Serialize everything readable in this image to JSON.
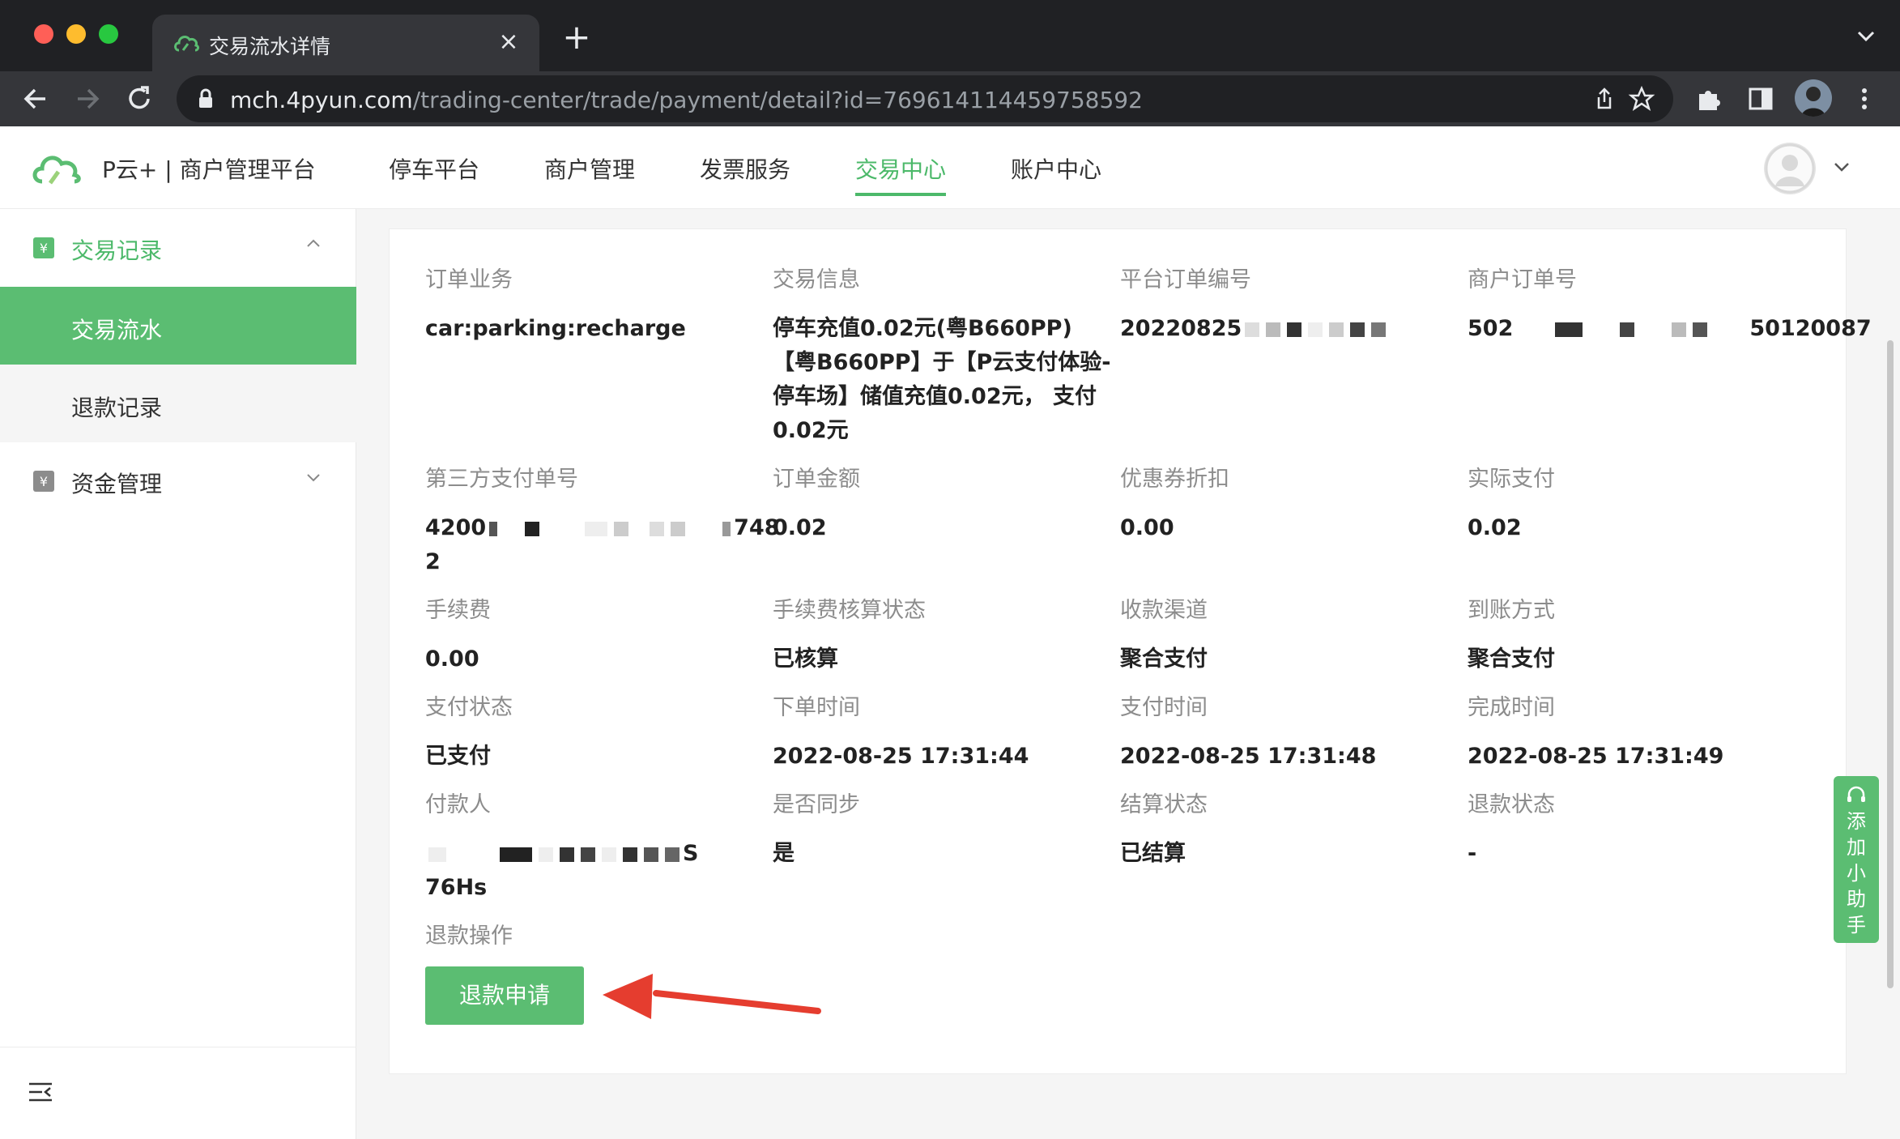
{
  "browser": {
    "tab_title": "交易流水详情",
    "tab_close": "×",
    "new_tab": "+",
    "url_host": "mch.4pyun.com",
    "url_path": "/trading-center/trade/payment/detail?id=769614114459758592"
  },
  "header": {
    "brand": "P云+ | 商户管理平台",
    "nav": [
      "停车平台",
      "商户管理",
      "发票服务",
      "交易中心",
      "账户中心"
    ],
    "active_nav": "交易中心"
  },
  "sidebar": {
    "groups": [
      {
        "label": "交易记录",
        "expanded": true,
        "items": [
          "交易流水",
          "退款记录"
        ],
        "active_item": "交易流水"
      },
      {
        "label": "资金管理",
        "expanded": false
      }
    ]
  },
  "detail": {
    "fields": [
      {
        "label": "订单业务",
        "value": "car:parking:recharge"
      },
      {
        "label": "交易信息",
        "value": "停车充值0.02元(粤B660PP)【粤B660PP】于【P云支付体验-停车场】储值充值0.02元， 支付0.02元"
      },
      {
        "label": "平台订单编号",
        "value_prefix": "20220825",
        "value_suffix": "",
        "masked": true
      },
      {
        "label": "商户订单号",
        "value_prefix": "502",
        "value_suffix": "50120087",
        "masked": true
      },
      {
        "label": "第三方支付单号",
        "value_prefix": "4200",
        "value_suffix": "748",
        "value_line2": "2",
        "masked": true
      },
      {
        "label": "订单金额",
        "value": "0.02"
      },
      {
        "label": "优惠券折扣",
        "value": "0.00"
      },
      {
        "label": "实际支付",
        "value": "0.02"
      },
      {
        "label": "手续费",
        "value": "0.00"
      },
      {
        "label": "手续费核算状态",
        "value": "已核算"
      },
      {
        "label": "收款渠道",
        "value": "聚合支付"
      },
      {
        "label": "到账方式",
        "value": "聚合支付"
      },
      {
        "label": "支付状态",
        "value": "已支付"
      },
      {
        "label": "下单时间",
        "value": "2022-08-25 17:31:44"
      },
      {
        "label": "支付时间",
        "value": "2022-08-25 17:31:48"
      },
      {
        "label": "完成时间",
        "value": "2022-08-25 17:31:49"
      },
      {
        "label": "付款人",
        "value_prefix": "",
        "value_suffix": "S",
        "value_line2": "76Hs",
        "masked": true
      },
      {
        "label": "是否同步",
        "value": "是"
      },
      {
        "label": "结算状态",
        "value": "已结算"
      },
      {
        "label": "退款状态",
        "value": "-"
      }
    ],
    "refund_label": "退款操作",
    "refund_button": "退款申请"
  },
  "helper": {
    "label": "添加小助手"
  },
  "colors": {
    "accent": "#5bbd72",
    "accent_text": "#4cb96a",
    "annotation_arrow": "#e53d2f"
  }
}
